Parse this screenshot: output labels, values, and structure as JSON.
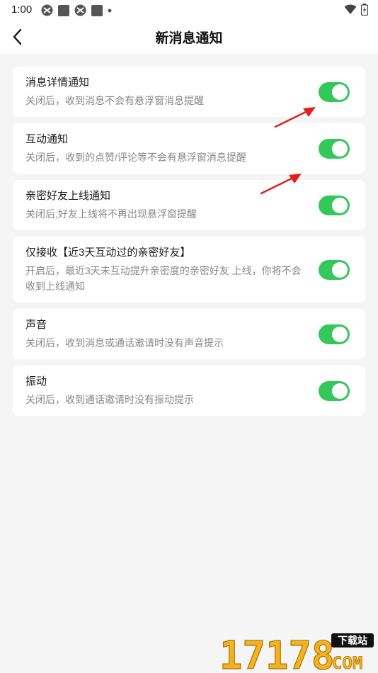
{
  "status_bar": {
    "time": "1:00",
    "icons": [
      "app-icon",
      "square-icon",
      "app-icon",
      "square-icon",
      "dot-icon"
    ],
    "right_icons": [
      "wifi-icon",
      "battery-icon"
    ]
  },
  "header": {
    "title": "新消息通知",
    "back_icon": "chevron-left-icon"
  },
  "settings": [
    {
      "title": "消息详情通知",
      "desc": "关闭后，收到消息不会有悬浮窗消息提醒",
      "enabled": true
    },
    {
      "title": "互动通知",
      "desc": "关闭后，收到的点赞/评论等不会有悬浮窗消息提醒",
      "enabled": true
    },
    {
      "title": "亲密好友上线通知",
      "desc": "关闭后,好友上线将不再出现悬浮窗提醒",
      "enabled": true
    },
    {
      "title": "仅接收【近3天互动过的亲密好友】",
      "desc": "开启后，最近3天未互动提升亲密度的亲密好友 上线，你将不会收到上线通知",
      "enabled": true
    },
    {
      "title": "声音",
      "desc": "关闭后，收到消息或通话邀请时没有声音提示",
      "enabled": true
    },
    {
      "title": "振动",
      "desc": "关闭后，收到通话邀请时没有振动提示",
      "enabled": true
    }
  ],
  "colors": {
    "toggle_on": "#34c759",
    "annotation_arrow": "#e0201a",
    "background": "#f5f5f5"
  },
  "watermark": {
    "brand": "17178",
    "tag": "下载站",
    "suffix": "COM"
  }
}
